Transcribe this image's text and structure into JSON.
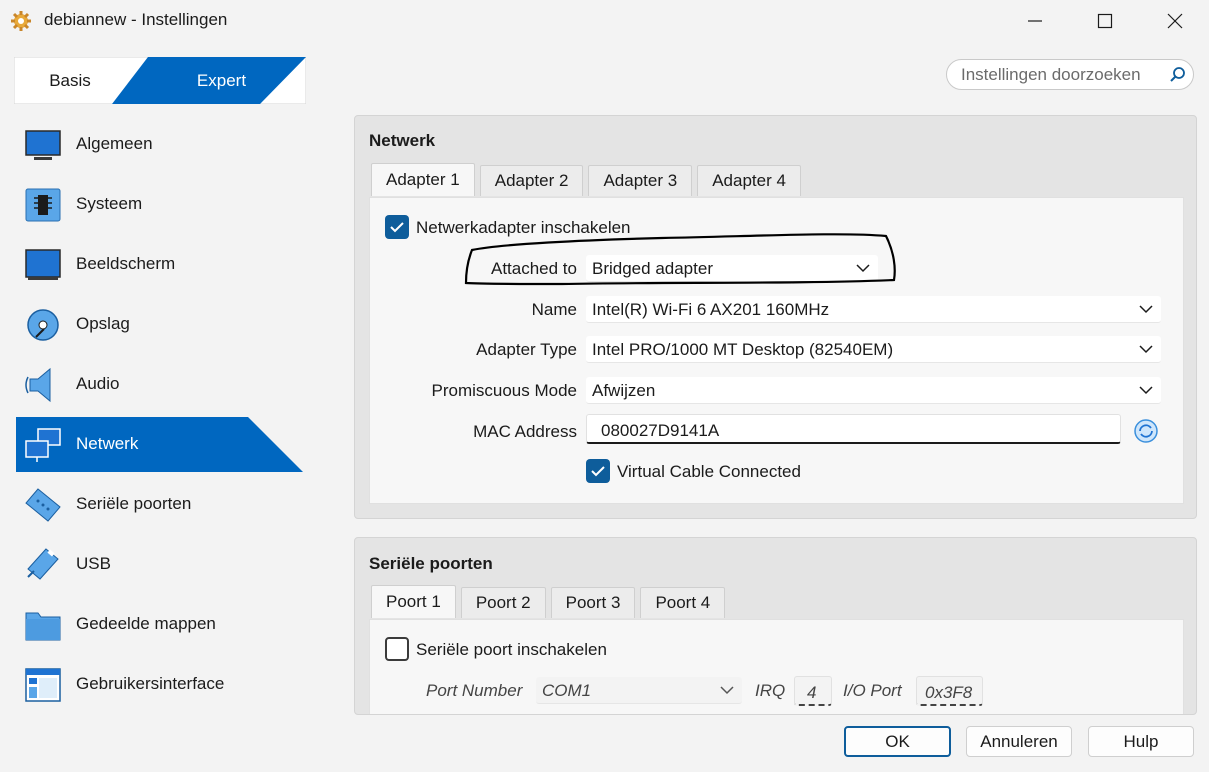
{
  "window": {
    "title": "debiannew - Instellingen",
    "icon": "gear-icon",
    "controls": [
      "minimize-icon",
      "maximize-icon",
      "close-icon"
    ]
  },
  "mode": {
    "basis_label": "Basis",
    "expert_label": "Expert",
    "selected": "Expert"
  },
  "search": {
    "placeholder": "Instellingen doorzoeken",
    "value": ""
  },
  "sidebar": {
    "items": [
      {
        "label": "Algemeen",
        "icon": "monitor-icon"
      },
      {
        "label": "Systeem",
        "icon": "chip-icon"
      },
      {
        "label": "Beeldscherm",
        "icon": "display-icon"
      },
      {
        "label": "Opslag",
        "icon": "disk-icon"
      },
      {
        "label": "Audio",
        "icon": "speaker-icon"
      },
      {
        "label": "Netwerk",
        "icon": "network-icon",
        "active": true
      },
      {
        "label": "Seriële poorten",
        "icon": "serial-port-icon"
      },
      {
        "label": "USB",
        "icon": "usb-icon"
      },
      {
        "label": "Gedeelde mappen",
        "icon": "folder-icon"
      },
      {
        "label": "Gebruikersinterface",
        "icon": "window-layout-icon"
      }
    ]
  },
  "network": {
    "title": "Netwerk",
    "tabs": [
      "Adapter 1",
      "Adapter 2",
      "Adapter 3",
      "Adapter 4"
    ],
    "active_tab": "Adapter 1",
    "enable_label": "Netwerkadapter inschakelen",
    "enable_checked": true,
    "attached_to": {
      "label": "Attached to",
      "value": "Bridged adapter"
    },
    "name": {
      "label": "Name",
      "value": "Intel(R) Wi-Fi 6 AX201 160MHz"
    },
    "adapter_type": {
      "label": "Adapter Type",
      "value": "Intel PRO/1000 MT Desktop (82540EM)"
    },
    "promiscuous": {
      "label": "Promiscuous Mode",
      "value": "Afwijzen"
    },
    "mac": {
      "label": "MAC Address",
      "value": "080027D9141A"
    },
    "cable_label": "Virtual Cable Connected",
    "cable_checked": true
  },
  "serial": {
    "title": "Seriële poorten",
    "tabs": [
      "Poort 1",
      "Poort 2",
      "Poort 3",
      "Poort 4"
    ],
    "active_tab": "Poort 1",
    "enable_label": "Seriële poort inschakelen",
    "enable_checked": false,
    "port_number_label": "Port Number",
    "port_number_value": "COM1",
    "irq_label": "IRQ",
    "irq_value": "4",
    "io_port_label": "I/O Port",
    "io_port_value": "0x3F8"
  },
  "buttons": {
    "ok": "OK",
    "cancel": "Annuleren",
    "help": "Hulp"
  },
  "colors": {
    "accent": "#0e5d9b",
    "accent_bright": "#0067c0",
    "annotation": "#000000"
  }
}
